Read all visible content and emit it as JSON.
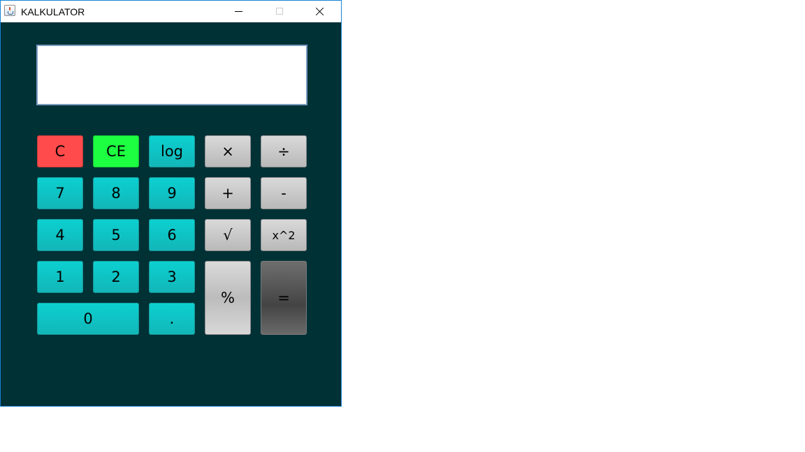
{
  "window": {
    "title": "KALKULATOR",
    "controls": [
      "minimize",
      "maximize",
      "close"
    ]
  },
  "display": {
    "value": ""
  },
  "keys": {
    "clear": "C",
    "clear_entry": "CE",
    "log": "log",
    "multiply": "×",
    "divide": "÷",
    "seven": "7",
    "eight": "8",
    "nine": "9",
    "plus": "+",
    "minus": "-",
    "four": "4",
    "five": "5",
    "six": "6",
    "sqrt": "√",
    "square": "x^2",
    "one": "1",
    "two": "2",
    "three": "3",
    "percent": "%",
    "equals": "=",
    "zero": "0",
    "decimal": "."
  },
  "colors": {
    "background": "#003135",
    "teal_key": "#0cc8c8",
    "gray_key": "#c8c8c8",
    "clear_key": "#ff4b4b",
    "clear_entry_key": "#1dff41",
    "equals_key": "#555555"
  }
}
